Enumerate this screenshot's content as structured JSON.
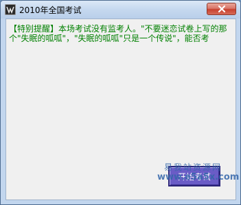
{
  "window": {
    "title": "2010年全国考试",
    "app_icon": "app-icon",
    "close_icon": "close-icon"
  },
  "main": {
    "notice_text": "【特别提醒】本场考试没有监考人。\"不要迷恋试卷上写的那个\"失眠的呱呱\"，\"失眠的呱呱\"只是一个传说\"，能否考",
    "notice_color": "#008000",
    "start_button_label": "开始考试",
    "start_button_color": "#6a5cc6"
  },
  "watermark": {
    "cn": "易我站资源网",
    "url": "www.e5a5x.com"
  }
}
